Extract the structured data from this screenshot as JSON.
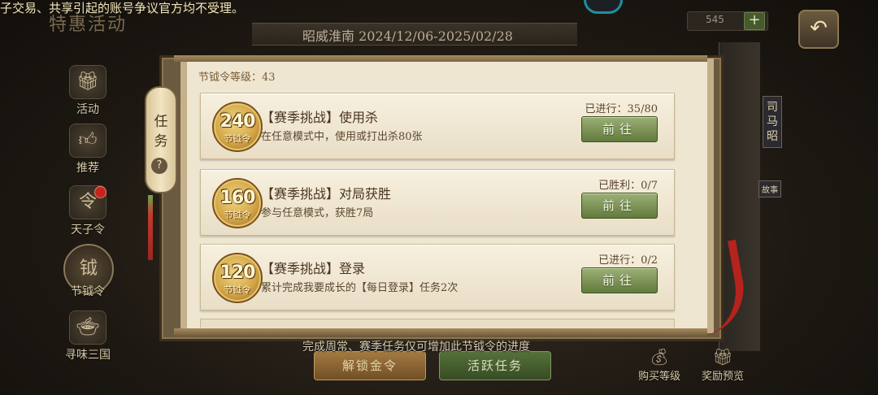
{
  "header": {
    "marquee": "子交易、共享引起的账号争议官方均不受理。",
    "faded_title": "特惠活动",
    "season_text": "昭威淮南 2024/12/06-2025/02/28",
    "coin_value": "545",
    "plus_label": "+",
    "back_icon": "back-arrow-icon"
  },
  "sidebar": {
    "items": [
      {
        "label": "活动",
        "icon": "gift-icon"
      },
      {
        "label": "推荐",
        "icon": "thumbs-up-icon"
      },
      {
        "label": "天子令",
        "icon": "token-icon"
      },
      {
        "label": "节钺令",
        "icon": "badge-icon"
      },
      {
        "label": "寻味三国",
        "icon": "food-icon"
      }
    ]
  },
  "panel": {
    "tab_label": "任务",
    "help_label": "?",
    "level_text": "节钺令等级：43",
    "tasks": [
      {
        "points": "240",
        "badge_sub": "节钺令",
        "title": "【赛季挑战】使用杀",
        "desc": "在任意模式中，使用或打出杀80张",
        "progress": "已进行：35/80",
        "button": "前往"
      },
      {
        "points": "160",
        "badge_sub": "节钺令",
        "title": "【赛季挑战】对局获胜",
        "desc": "参与任意模式，获胜7局",
        "progress": "已胜利：0/7",
        "button": "前往"
      },
      {
        "points": "120",
        "badge_sub": "节钺令",
        "title": "【赛季挑战】登录",
        "desc": "累计完成我要成长的【每日登录】任务2次",
        "progress": "已进行：0/2",
        "button": "前往"
      }
    ]
  },
  "right": {
    "char_name": "司马昭",
    "story_label": "故事"
  },
  "footer": {
    "note": "完成周常、赛季任务仅可增加此节钺令的进度",
    "unlock_button": "解锁金令",
    "active_tasks_button": "活跃任务",
    "buy_level": "购买等级",
    "reward_preview": "奖励预览"
  },
  "colors": {
    "accent_green": "#627a3c",
    "badge_gold": "#d3a548",
    "parchment": "#efe6d2"
  }
}
